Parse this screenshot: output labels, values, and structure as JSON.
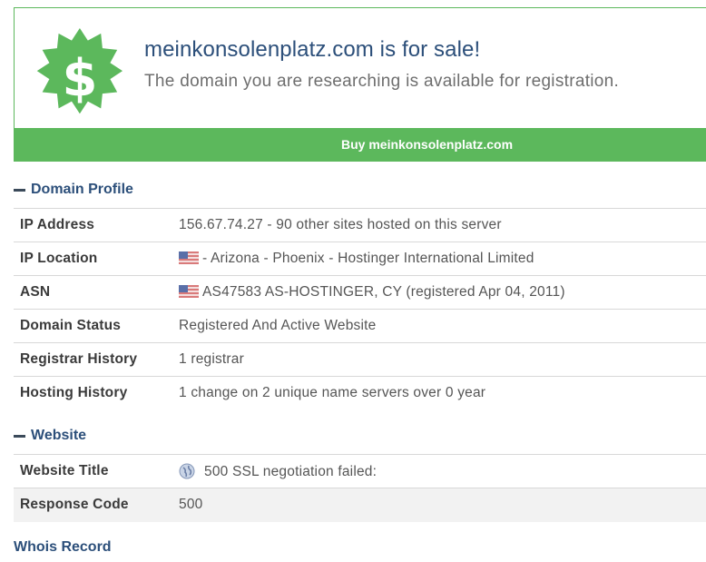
{
  "sale": {
    "title": "meinkonsolenplatz.com is for sale!",
    "subtitle": "The domain you are researching is available for registration.",
    "buy_label": "Buy meinkonsolenplatz.com",
    "badge_icon": "dollar-badge-icon",
    "accent_color": "#5cb85c"
  },
  "domain_profile": {
    "header": "Domain Profile",
    "rows": [
      {
        "label": "IP Address",
        "value": "156.67.74.27 - 90 other sites hosted on this server"
      },
      {
        "label": "IP Location",
        "value": "- Arizona - Phoenix - Hostinger International Limited",
        "icon": "us-flag-icon"
      },
      {
        "label": "ASN",
        "value": "AS47583 AS-HOSTINGER, CY (registered Apr 04, 2011)",
        "icon": "us-flag-icon"
      },
      {
        "label": "Domain Status",
        "value": "Registered And Active Website"
      },
      {
        "label": "Registrar History",
        "value": "1 registrar"
      },
      {
        "label": "Hosting History",
        "value": "1 change on 2 unique name servers over 0 year"
      }
    ]
  },
  "website": {
    "header": "Website",
    "rows": [
      {
        "label": "Website Title",
        "value": "500 SSL negotiation failed:",
        "icon": "globe-icon"
      },
      {
        "label": "Response Code",
        "value": "500"
      }
    ]
  },
  "whois": {
    "label": "Whois Record"
  }
}
